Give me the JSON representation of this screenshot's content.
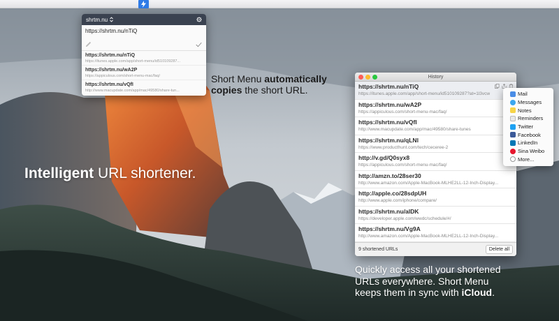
{
  "menubar": {
    "app_icon": "lightning-bolt-icon"
  },
  "popover": {
    "domain": "shrtm.nu",
    "current_url": "https://shrtm.nu/nTiQ",
    "items": [
      {
        "short": "https://shrtm.nu/nTiQ",
        "long": "https://itunes.apple.com/app/short-menu/id510109287..."
      },
      {
        "short": "https://shrtm.nu/wA2P",
        "long": "https://appiculous.com/short-menu-mac/faq/"
      },
      {
        "short": "https://shrtm.nu/vQfI",
        "long": "http://www.macupdate.com/app/mac/49580/share-tun..."
      }
    ]
  },
  "captions": {
    "copy_prefix": "Short Menu ",
    "copy_bold": "automatically copies",
    "copy_suffix": " the short URL.",
    "headline_bold": "Intelligent",
    "headline_rest": " URL shortener.",
    "sync_text": "Quickly access all your shortened URLs everywhere. Short Menu keeps them in sync with ",
    "sync_bold": "iCloud",
    "sync_end": "."
  },
  "history": {
    "title": "History",
    "rows": [
      {
        "short": "https://shrtm.nu/nTiQ",
        "long": "https://itunes.apple.com/app/short-menu/id510109287?at=1l3vcw"
      },
      {
        "short": "https://shrtm.nu/wA2P",
        "long": "https://appiculous.com/short-menu-mac/faq/"
      },
      {
        "short": "https://shrtm.nu/vQfI",
        "long": "http://www.macupdate.com/app/mac/49580/share-tunes"
      },
      {
        "short": "https://shrtm.nu/qLNl",
        "long": "https://www.producthunt.com/tech/ceceree-2"
      },
      {
        "short": "http://v.gd/Q0syx8",
        "long": "https://appiculous.com/short-menu-mac/faq/"
      },
      {
        "short": "http://amzn.to/28ser30",
        "long": "http://www.amazon.com/Apple-MacBook-MLHE2LL-12-Inch-Display..."
      },
      {
        "short": "http://apple.co/28sdpUH",
        "long": "http://www.apple.com/iphone/compare/"
      },
      {
        "short": "https://shrtm.nu/alDK",
        "long": "https://developer.apple.com/wwdc/schedule/#/"
      },
      {
        "short": "https://shrtm.nu/Vg9A",
        "long": "http://www.amazon.com/Apple-MacBook-MLHE2LL-12-Inch-Display..."
      }
    ],
    "count_label": "9 shortened URLs",
    "delete_label": "Delete all"
  },
  "share_menu": {
    "items": [
      {
        "label": "Mail",
        "icon": "mail-icon",
        "color": "#4a8de6"
      },
      {
        "label": "Messages",
        "icon": "messages-icon",
        "color": "#3aa7f0"
      },
      {
        "label": "Notes",
        "icon": "notes-icon",
        "color": "#f7d448"
      },
      {
        "label": "Reminders",
        "icon": "reminders-icon",
        "color": "#e8e8e8"
      },
      {
        "label": "Twitter",
        "icon": "twitter-icon",
        "color": "#1da1f2"
      },
      {
        "label": "Facebook",
        "icon": "facebook-icon",
        "color": "#3b5998"
      },
      {
        "label": "LinkedIn",
        "icon": "linkedin-icon",
        "color": "#0077b5"
      },
      {
        "label": "Sina Weibo",
        "icon": "weibo-icon",
        "color": "#e6162d"
      }
    ],
    "more_label": "More..."
  }
}
